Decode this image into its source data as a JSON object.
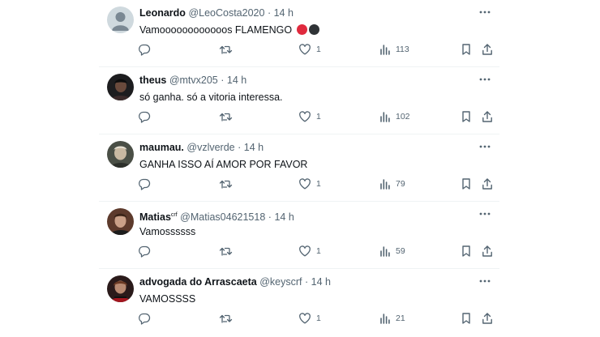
{
  "colors": {
    "text": "#0f1419",
    "secondary": "#536471",
    "divider": "#eff3f4",
    "red": "#e02a3e",
    "black": "#2f3336"
  },
  "tweets": [
    {
      "name": "Leonardo",
      "badge": "",
      "handle": "@LeoCosta2020",
      "time": "14 h",
      "text": "Vamoooooooooooos FLAMENGO",
      "emojis": [
        "red-circle",
        "black-circle"
      ],
      "likes": "1",
      "views": "113",
      "avatar": "default-avatar"
    },
    {
      "name": "theus",
      "badge": "",
      "handle": "@mtvx205",
      "time": "14 h",
      "text": "só ganha. só a vitoria interessa.",
      "emojis": [],
      "likes": "1",
      "views": "102",
      "avatar": "user-photo"
    },
    {
      "name": "maumau.",
      "badge": "",
      "handle": "@vzlverde",
      "time": "14 h",
      "text": "GANHA ISSO AÍ AMOR POR FAVOR",
      "emojis": [],
      "likes": "1",
      "views": "79",
      "avatar": "user-photo"
    },
    {
      "name": "Matias",
      "badge": "crf",
      "handle": "@Matias04621518",
      "time": "14 h",
      "text": "Vamossssss",
      "emojis": [],
      "likes": "1",
      "views": "59",
      "avatar": "user-photo"
    },
    {
      "name": "advogada do Arrascaeta",
      "badge": "",
      "handle": "@keyscrf",
      "time": "14 h",
      "text": "VAMOSSSS",
      "emojis": [],
      "likes": "1",
      "views": "21",
      "avatar": "user-photo"
    }
  ],
  "icons": {
    "reply": "reply-icon",
    "repost": "repost-icon",
    "like": "heart-icon",
    "views": "views-icon",
    "bookmark": "bookmark-icon",
    "share": "share-icon",
    "more": "more-icon"
  }
}
